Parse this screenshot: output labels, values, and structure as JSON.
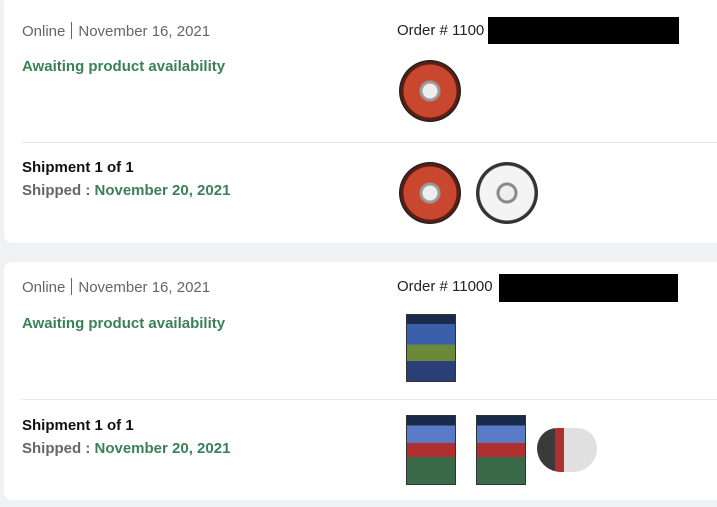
{
  "orders": [
    {
      "channel": "Online",
      "date": "November 16, 2021",
      "order_prefix": "Order # 1100",
      "status": "Awaiting product availability",
      "shipment_title": "Shipment 1 of 1",
      "shipped_label": "Shipped : ",
      "shipped_date": "November 20, 2021"
    },
    {
      "channel": "Online",
      "date": "November 16, 2021",
      "order_prefix": "Order # 11000",
      "status": "Awaiting product availability",
      "shipment_title": "Shipment 1 of 1",
      "shipped_label": "Shipped : ",
      "shipped_date": "November 20, 2021"
    }
  ],
  "colors": {
    "status_green": "#3b8058",
    "redaction": "#000000",
    "background": "#f0f1f3"
  },
  "icons": [
    "game-disc-icon",
    "soccer-disc-icon",
    "game-box-icon",
    "controller-icon"
  ]
}
